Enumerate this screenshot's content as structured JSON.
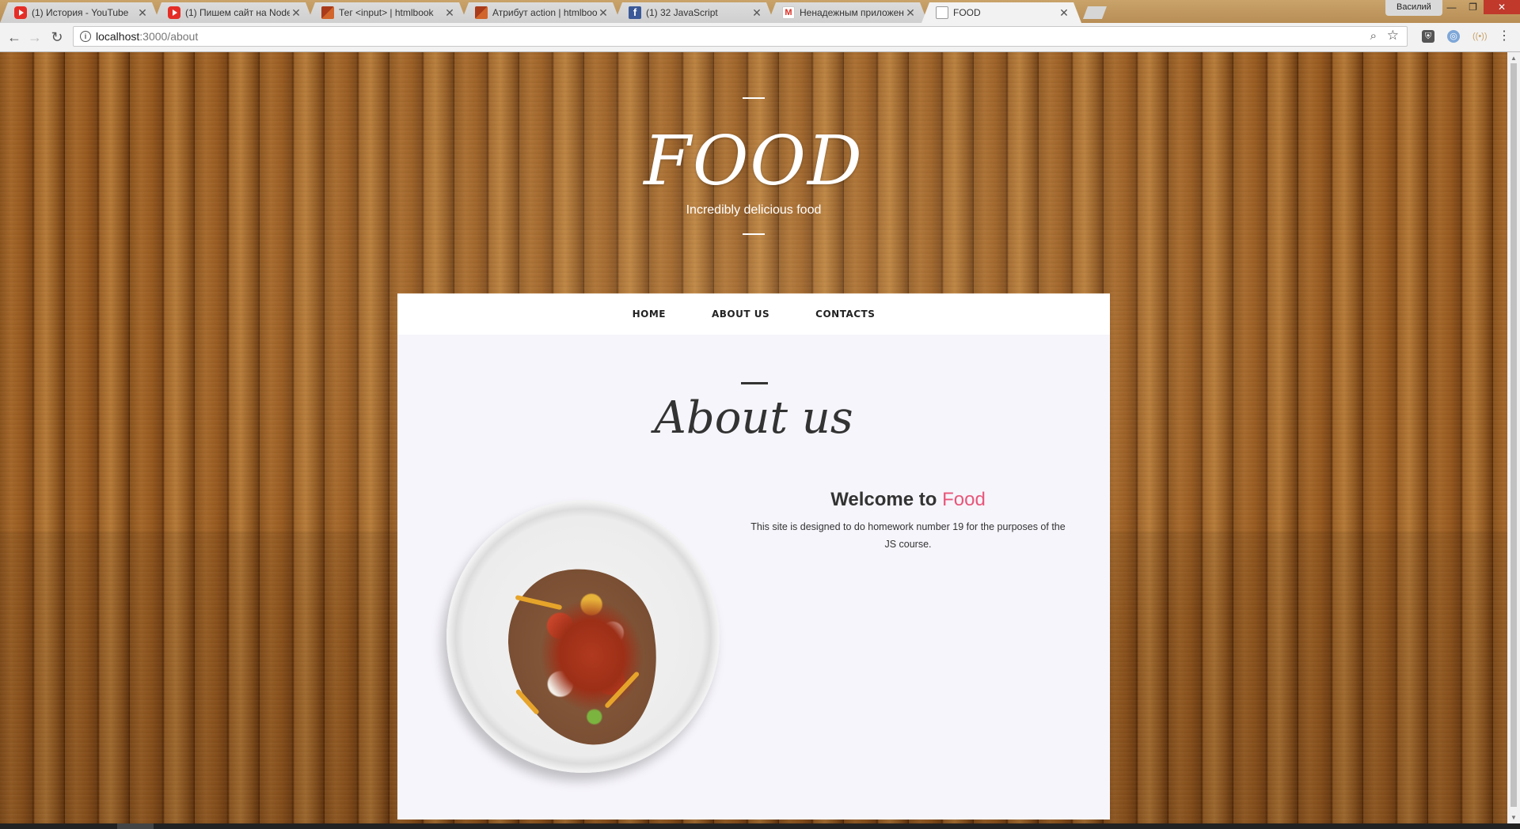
{
  "browser": {
    "tabs": [
      {
        "title": "(1) История - YouTube",
        "favicon": "youtube-icon"
      },
      {
        "title": "(1) Пишем сайт на Node",
        "favicon": "youtube-icon"
      },
      {
        "title": "Тег <input> | htmlbook",
        "favicon": "htmlbook-icon"
      },
      {
        "title": "Атрибут action | htmlboo",
        "favicon": "htmlbook-icon"
      },
      {
        "title": "(1) 32 JavaScript",
        "favicon": "facebook-icon"
      },
      {
        "title": "Ненадежным приложен",
        "favicon": "gmail-icon"
      },
      {
        "title": "FOOD",
        "favicon": "page-icon"
      }
    ],
    "profile_name": "Василий",
    "url_host": "localhost",
    "url_path": ":3000/about"
  },
  "hero": {
    "logo": "FOOD",
    "tagline": "Incredibly delicious food"
  },
  "nav": {
    "items": [
      "HOME",
      "ABOUT US",
      "CONTACTS"
    ]
  },
  "about": {
    "title": "About us",
    "welcome_prefix": "Welcome to",
    "welcome_accent": "Food",
    "description": "This site is designed to do homework number 19 for the purposes of the JS course."
  },
  "colors": {
    "accent": "#e8567a",
    "card_background": "#f6f5fb",
    "text": "#333333"
  }
}
